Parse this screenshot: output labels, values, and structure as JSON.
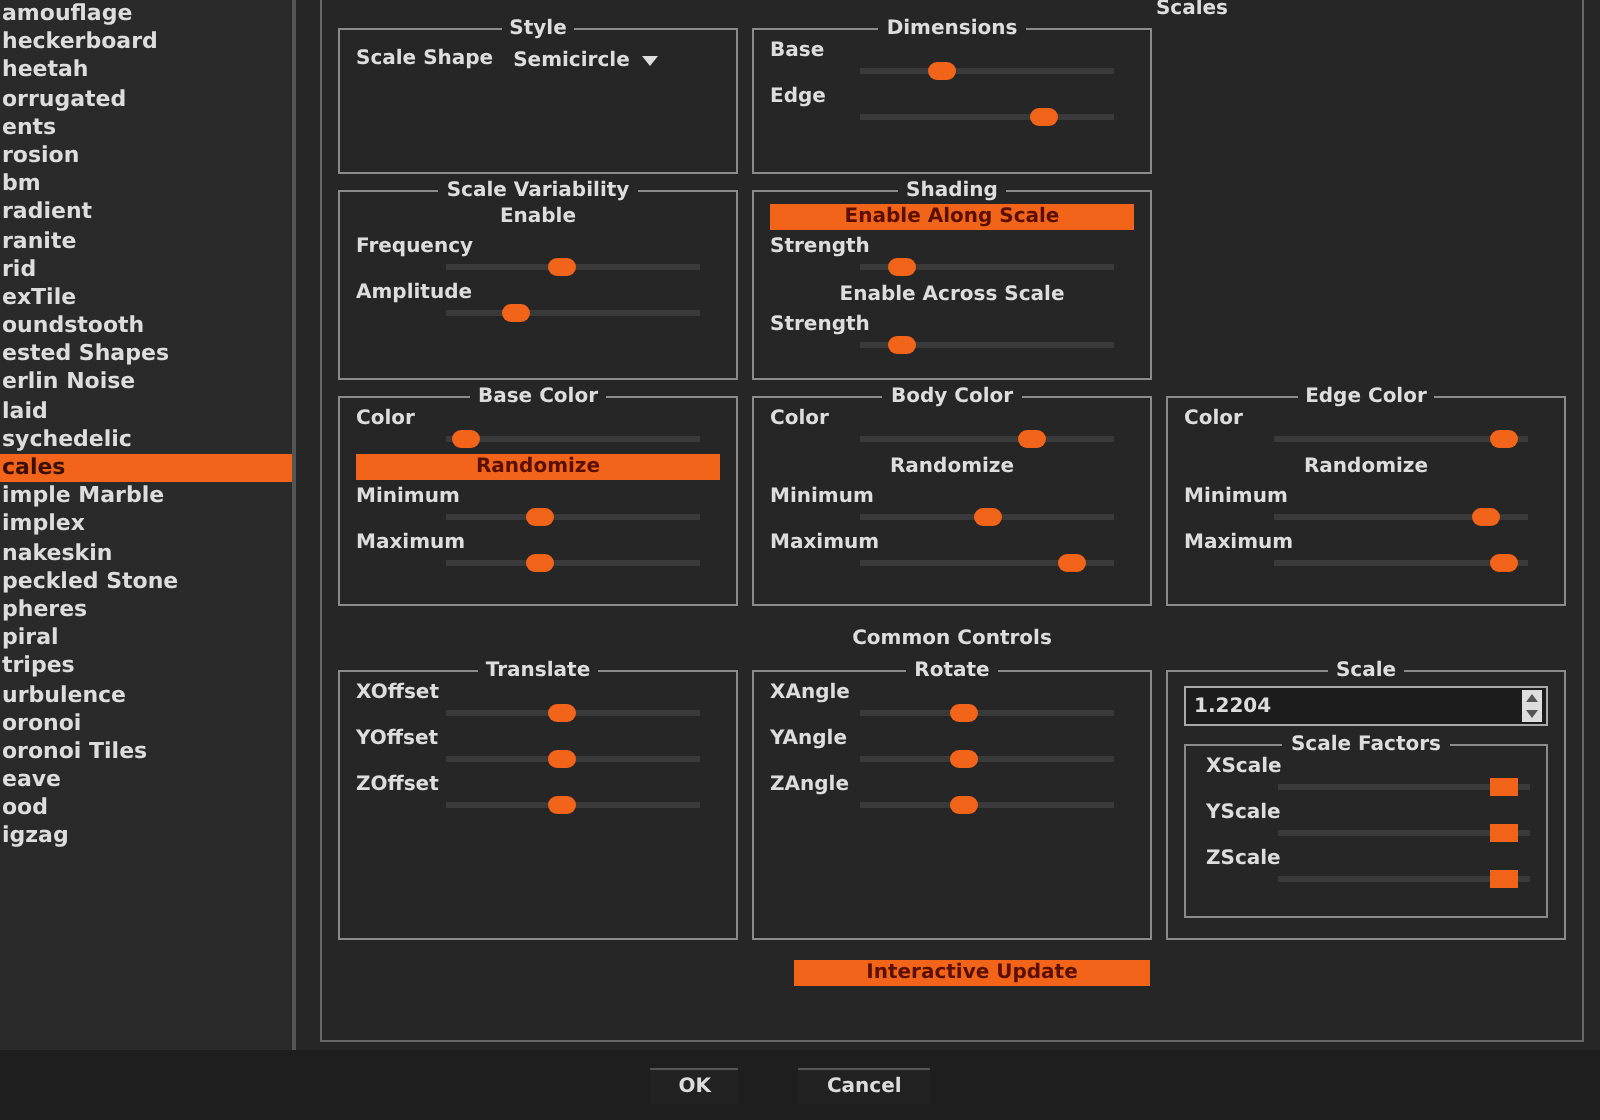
{
  "title": "Scales",
  "textures": [
    {
      "label": "amouflage",
      "selected": false
    },
    {
      "label": "heckerboard",
      "selected": false
    },
    {
      "label": "heetah",
      "selected": false
    },
    {
      "label": "orrugated",
      "selected": false
    },
    {
      "label": "ents",
      "selected": false
    },
    {
      "label": "rosion",
      "selected": false
    },
    {
      "label": "bm",
      "selected": false
    },
    {
      "label": "radient",
      "selected": false
    },
    {
      "label": "ranite",
      "selected": false
    },
    {
      "label": "rid",
      "selected": false
    },
    {
      "label": "exTile",
      "selected": false
    },
    {
      "label": "oundstooth",
      "selected": false
    },
    {
      "label": "ested Shapes",
      "selected": false
    },
    {
      "label": "erlin Noise",
      "selected": false
    },
    {
      "label": "laid",
      "selected": false
    },
    {
      "label": "sychedelic",
      "selected": false
    },
    {
      "label": "cales",
      "selected": true
    },
    {
      "label": "imple Marble",
      "selected": false
    },
    {
      "label": "implex",
      "selected": false
    },
    {
      "label": "nakeskin",
      "selected": false
    },
    {
      "label": "peckled Stone",
      "selected": false
    },
    {
      "label": "pheres",
      "selected": false
    },
    {
      "label": "piral",
      "selected": false
    },
    {
      "label": "tripes",
      "selected": false
    },
    {
      "label": "urbulence",
      "selected": false
    },
    {
      "label": "oronoi",
      "selected": false
    },
    {
      "label": "oronoi Tiles",
      "selected": false
    },
    {
      "label": "eave",
      "selected": false
    },
    {
      "label": "ood",
      "selected": false
    },
    {
      "label": "igzag",
      "selected": false
    }
  ],
  "rows": [
    [
      {
        "title": "Style",
        "items": [
          {
            "kind": "dropdown",
            "label": "Scale Shape",
            "value": "Semicircle"
          }
        ]
      },
      {
        "title": "Dimensions",
        "items": [
          {
            "kind": "slider",
            "label": "Base",
            "level": 0.3
          },
          {
            "kind": "slider",
            "label": "Edge",
            "level": 0.75
          }
        ]
      }
    ],
    [
      {
        "title": "Scale Variability",
        "items": [
          {
            "kind": "toggle",
            "label": "Enable",
            "on": false
          },
          {
            "kind": "slider",
            "label": "Frequency",
            "level": 0.45
          },
          {
            "kind": "slider",
            "label": "Amplitude",
            "level": 0.25
          }
        ]
      },
      {
        "title": "Shading",
        "items": [
          {
            "kind": "toggle",
            "label": "Enable Along Scale",
            "on": true
          },
          {
            "kind": "slider",
            "label": "Strength",
            "level": 0.12
          },
          {
            "kind": "toggle",
            "label": "Enable Across Scale",
            "on": false
          },
          {
            "kind": "slider",
            "label": "Strength",
            "level": 0.12
          }
        ]
      }
    ],
    [
      {
        "title": "Base Color",
        "items": [
          {
            "kind": "slider",
            "label": "Color",
            "level": 0.03
          },
          {
            "kind": "toggle",
            "label": "Randomize",
            "on": true
          },
          {
            "kind": "slider",
            "label": "Minimum",
            "level": 0.35
          },
          {
            "kind": "slider",
            "label": "Maximum",
            "level": 0.35
          }
        ]
      },
      {
        "title": "Body Color",
        "items": [
          {
            "kind": "slider",
            "label": "Color",
            "level": 0.7
          },
          {
            "kind": "toggle",
            "label": "Randomize",
            "on": false
          },
          {
            "kind": "slider",
            "label": "Minimum",
            "level": 0.5
          },
          {
            "kind": "slider",
            "label": "Maximum",
            "level": 0.88
          }
        ]
      },
      {
        "title": "Edge Color",
        "items": [
          {
            "kind": "slider",
            "label": "Color",
            "level": 0.96
          },
          {
            "kind": "toggle",
            "label": "Randomize",
            "on": false
          },
          {
            "kind": "slider",
            "label": "Minimum",
            "level": 0.88
          },
          {
            "kind": "slider",
            "label": "Maximum",
            "level": 0.96
          }
        ]
      }
    ]
  ],
  "common_title": "Common Controls",
  "common": [
    {
      "title": "Translate",
      "items": [
        {
          "kind": "slider",
          "label": "XOffset",
          "level": 0.45
        },
        {
          "kind": "slider",
          "label": "YOffset",
          "level": 0.45
        },
        {
          "kind": "slider",
          "label": "ZOffset",
          "level": 0.45
        }
      ]
    },
    {
      "title": "Rotate",
      "items": [
        {
          "kind": "slider",
          "label": "XAngle",
          "level": 0.4
        },
        {
          "kind": "slider",
          "label": "YAngle",
          "level": 0.4
        },
        {
          "kind": "slider",
          "label": "ZAngle",
          "level": 0.4
        }
      ]
    },
    {
      "title": "Scale",
      "items": [
        {
          "kind": "number",
          "value": "1.2204"
        },
        {
          "kind": "group",
          "title": "Scale Factors",
          "items": [
            {
              "kind": "slider",
              "label": "XScale",
              "level": 0.95
            },
            {
              "kind": "slider",
              "label": "YScale",
              "level": 0.95
            },
            {
              "kind": "slider",
              "label": "ZScale",
              "level": 0.95
            }
          ]
        }
      ]
    }
  ],
  "interactive_update": {
    "label": "Interactive Update",
    "on": true
  },
  "buttons": [
    "OK",
    "Cancel"
  ]
}
